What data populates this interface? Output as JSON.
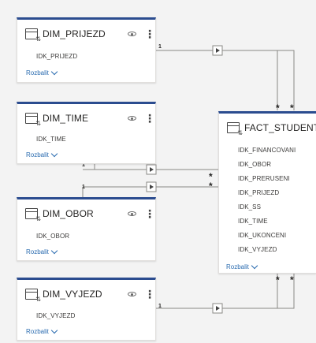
{
  "tables": [
    {
      "name": "DIM_PRIJEZD",
      "fields": [
        "IDK_PRIJEZD"
      ],
      "expand_label": "Rozbalit"
    },
    {
      "name": "DIM_TIME",
      "fields": [
        "IDK_TIME"
      ],
      "expand_label": "Rozbalit"
    },
    {
      "name": "DIM_OBOR",
      "fields": [
        "IDK_OBOR"
      ],
      "expand_label": "Rozbalit"
    },
    {
      "name": "DIM_VYJEZD",
      "fields": [
        "IDK_VYJEZD"
      ],
      "expand_label": "Rozbalit"
    },
    {
      "name": "FACT_STUDENT",
      "fields": [
        "IDK_FINANCOVANI",
        "IDK_OBOR",
        "IDK_PRERUSENI",
        "IDK_PRIJEZD",
        "IDK_SS",
        "IDK_TIME",
        "IDK_UKONCENI",
        "IDK_VYJEZD"
      ],
      "expand_label": "Rozbalit"
    }
  ],
  "relationships": {
    "one_label": "1",
    "many_label": "*"
  },
  "colors": {
    "header_accent": "#2b4c8f",
    "link": "#2b6cb0",
    "line": "#8a8886"
  }
}
